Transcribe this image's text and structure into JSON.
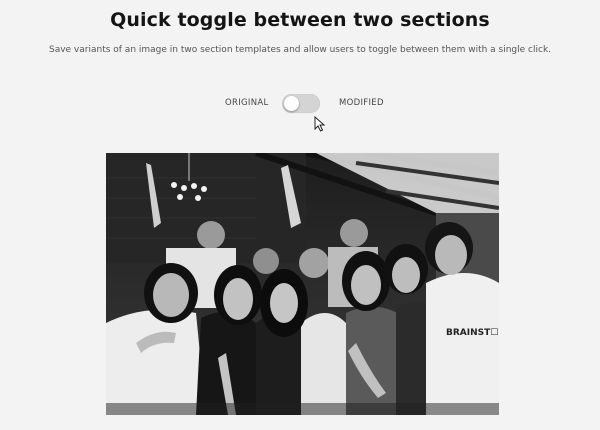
{
  "header": {
    "title": "Quick toggle between two sections",
    "subtitle": "Save variants of an image in two section templates and allow users to toggle between them with a single click."
  },
  "toggle": {
    "left_label": "ORIGINAL",
    "right_label": "MODIFIED",
    "state": "original"
  },
  "image": {
    "description": "Black-and-white group photo of friends",
    "shirt_text": "BRAINSTORM"
  },
  "icons": [
    "mouse-cursor-icon",
    "chandelier"
  ]
}
